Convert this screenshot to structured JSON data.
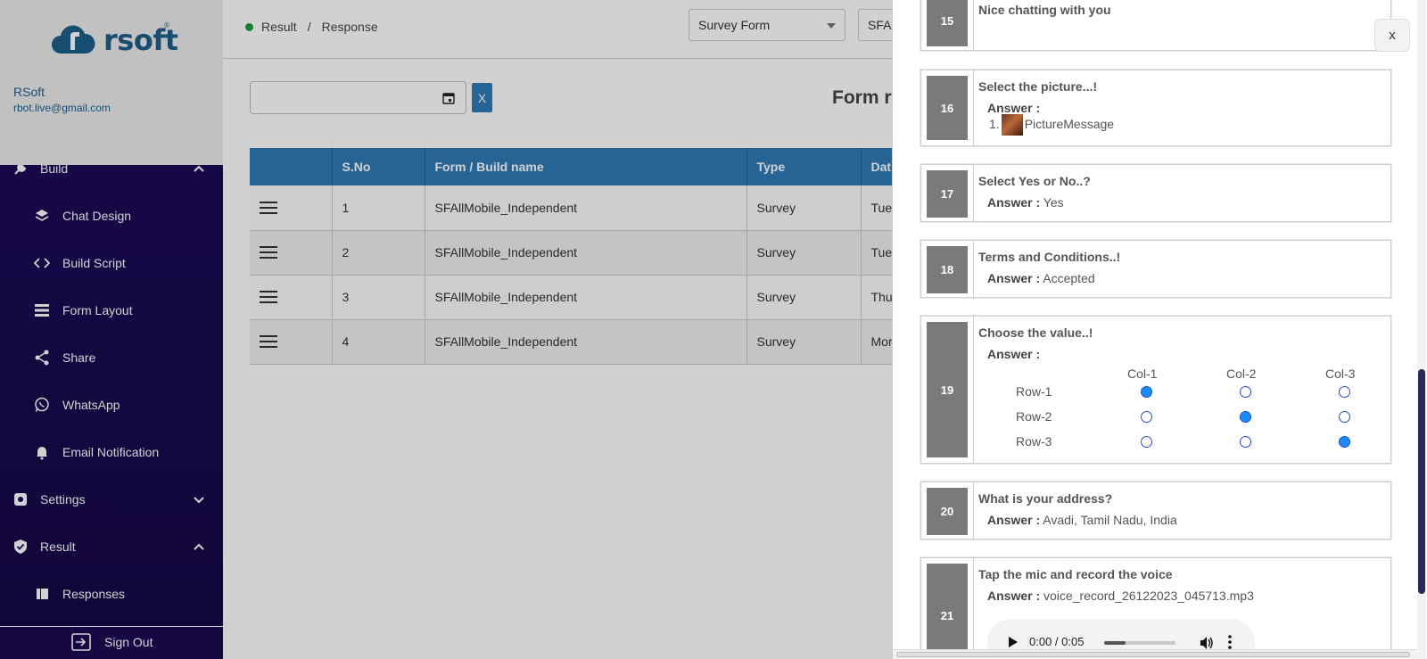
{
  "sidebar": {
    "brand": "rsoft",
    "brand_mark": "®",
    "user_name": "RSoft",
    "user_email": "rbot.live@gmail.com",
    "items": [
      {
        "label": "Build",
        "icon": "wrench-icon",
        "level": "main",
        "chevron": "up"
      },
      {
        "label": "Chat Design",
        "icon": "layers-icon",
        "level": "sub"
      },
      {
        "label": "Build Script",
        "icon": "code-icon",
        "level": "sub"
      },
      {
        "label": "Form Layout",
        "icon": "list-icon",
        "level": "sub"
      },
      {
        "label": "Share",
        "icon": "share-icon",
        "level": "sub"
      },
      {
        "label": "WhatsApp",
        "icon": "whatsapp-icon",
        "level": "sub"
      },
      {
        "label": "Email Notification",
        "icon": "bell-icon",
        "level": "sub"
      },
      {
        "label": "Settings",
        "icon": "gear-icon",
        "level": "main",
        "chevron": "down"
      },
      {
        "label": "Result",
        "icon": "shield-check-icon",
        "level": "main",
        "chevron": "up"
      },
      {
        "label": "Responses",
        "icon": "book-icon",
        "level": "sub"
      }
    ],
    "signout_label": "Sign Out"
  },
  "header": {
    "crumb_1": "Result",
    "crumb_sep": "/",
    "crumb_2": "Response",
    "select_form_type": "Survey Form",
    "select_form_name": "SFA"
  },
  "filters": {
    "date_value": "",
    "clear_label": "X"
  },
  "content": {
    "title": "Form re"
  },
  "table": {
    "columns": [
      "",
      "S.No",
      "Form / Build name",
      "Type",
      "Dat"
    ],
    "rows": [
      {
        "sno": "1",
        "name": "SFAllMobile_Independent",
        "type": "Survey",
        "date": "Tue"
      },
      {
        "sno": "2",
        "name": "SFAllMobile_Independent",
        "type": "Survey",
        "date": "Tue"
      },
      {
        "sno": "3",
        "name": "SFAllMobile_Independent",
        "type": "Survey",
        "date": "Thu"
      },
      {
        "sno": "4",
        "name": "SFAllMobile_Independent",
        "type": "Survey",
        "date": "Mor"
      }
    ]
  },
  "panel": {
    "close_label": "x",
    "answer_label": "Answer :",
    "q15": {
      "num": "15",
      "question": "Nice chatting with you"
    },
    "q16": {
      "num": "16",
      "question": "Select the picture...!",
      "answer_prefix": "1.",
      "answer": "PictureMessage"
    },
    "q17": {
      "num": "17",
      "question": "Select Yes or No..?",
      "answer": "Yes"
    },
    "q18": {
      "num": "18",
      "question": "Terms and Conditions..!",
      "answer": "Accepted"
    },
    "q19": {
      "num": "19",
      "question": "Choose the value..!",
      "cols": [
        "Col-1",
        "Col-2",
        "Col-3"
      ],
      "rows": [
        "Row-1",
        "Row-2",
        "Row-3"
      ],
      "selected": [
        0,
        1,
        2
      ]
    },
    "q20": {
      "num": "20",
      "question": "What is your address?",
      "answer": "Avadi, Tamil Nadu, India"
    },
    "q21": {
      "num": "21",
      "question": "Tap the mic and record the voice",
      "answer": "voice_record_26122023_045713.mp3",
      "audio_time": "0:00 / 0:05",
      "audio_progress": 0.3
    }
  },
  "colors": {
    "sidebar_bg": "#1a0a52",
    "brand_blue": "#1c5e8a",
    "table_header": "#2f7ab8",
    "radio_on": "#1a8cff"
  }
}
